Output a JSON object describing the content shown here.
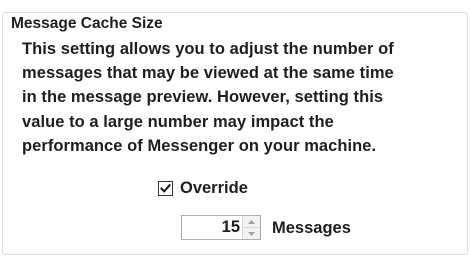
{
  "group": {
    "title": "Message Cache Size"
  },
  "description": {
    "lines": [
      "This setting allows you to adjust the number of",
      "messages that may be viewed at the same time",
      "in the message preview.  However, setting this",
      "value to a large number may impact the",
      "performance of Messenger on your machine."
    ]
  },
  "override": {
    "label": "Override",
    "checked": true
  },
  "cache_size": {
    "value": "15",
    "unit_label": "Messages"
  },
  "icons": {
    "checkmark": "checkmark-icon",
    "spin_up": "spin-up-arrow-icon",
    "spin_down": "spin-down-arrow-icon"
  },
  "colors": {
    "group_border": "#d5dfe5",
    "text": "#1e1e1e",
    "arrow": "#a0a0a0"
  }
}
